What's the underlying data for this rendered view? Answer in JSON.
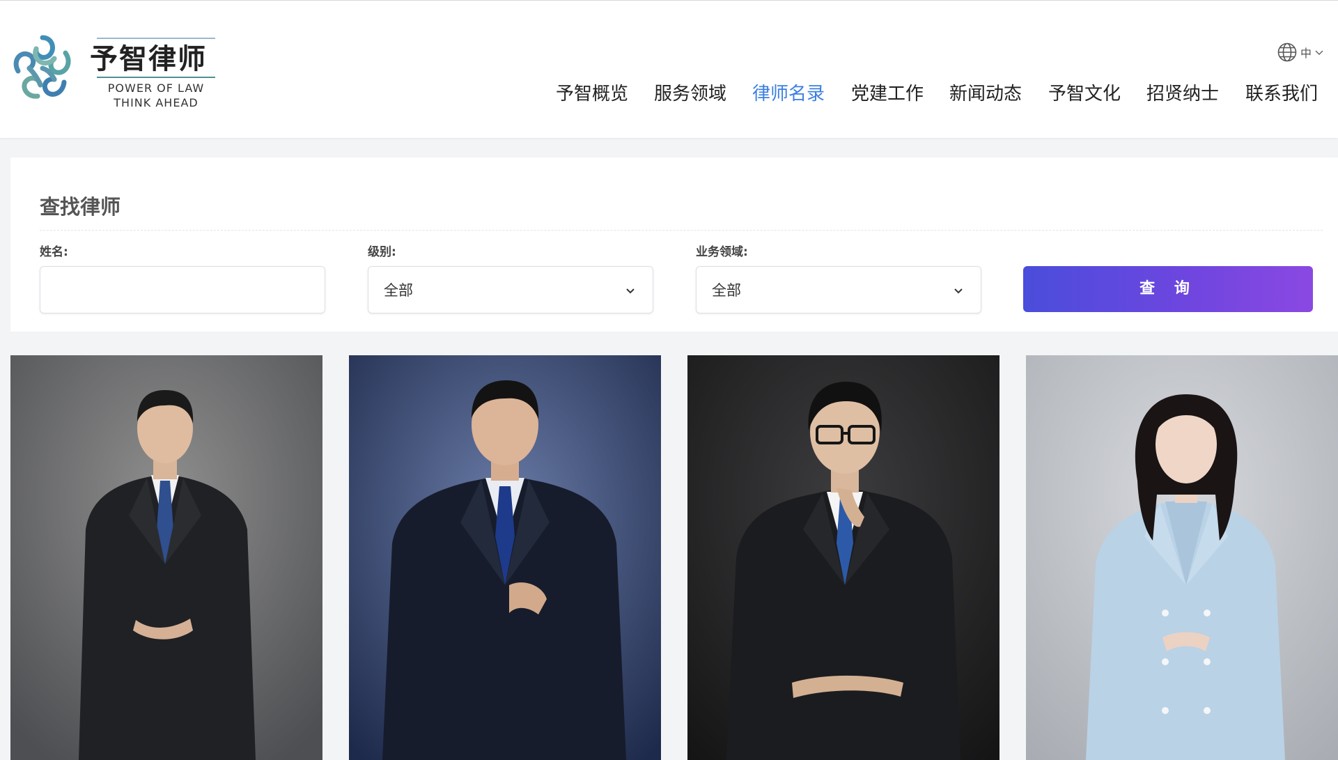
{
  "brand": {
    "name_cn": "予智律师",
    "tagline_line1": "POWER OF LAW",
    "tagline_line2": "THINK AHEAD"
  },
  "language": {
    "current": "中"
  },
  "nav": {
    "items": [
      {
        "label": "予智概览"
      },
      {
        "label": "服务领域"
      },
      {
        "label": "律师名录",
        "active": true
      },
      {
        "label": "党建工作"
      },
      {
        "label": "新闻动态"
      },
      {
        "label": "予智文化"
      },
      {
        "label": "招贤纳士"
      },
      {
        "label": "联系我们"
      }
    ]
  },
  "search": {
    "title": "查找律师",
    "name_label": "姓名:",
    "name_value": "",
    "level_label": "级别:",
    "level_value": "全部",
    "area_label": "业务领域:",
    "area_value": "全部",
    "query_label": "查 询"
  },
  "colors": {
    "accent_nav": "#3b7fe0",
    "button_start": "#4a4ddb",
    "button_end": "#8b48e2"
  },
  "lawyers": [
    {
      "photo": "man-dark-suit-gray-bg"
    },
    {
      "photo": "man-dark-suit-blue-bg"
    },
    {
      "photo": "man-glasses-dark-bg"
    },
    {
      "photo": "woman-light-blue-dress"
    }
  ]
}
